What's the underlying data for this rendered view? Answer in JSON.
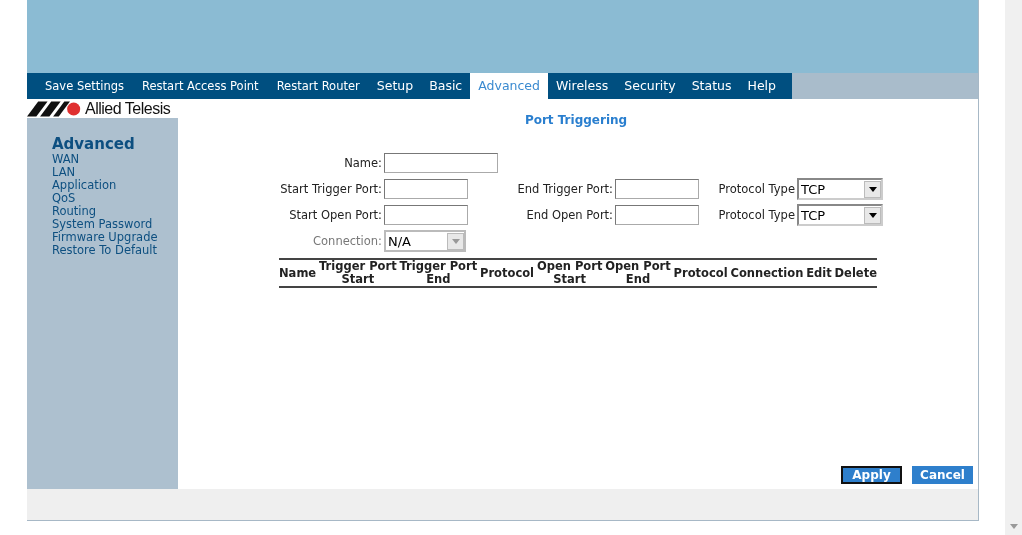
{
  "nav": [
    {
      "label": "Save Settings",
      "selected": false
    },
    {
      "label": "Restart Access Point",
      "selected": false
    },
    {
      "label": "Restart Router",
      "selected": false
    },
    {
      "label": "Setup",
      "selected": false
    },
    {
      "label": "Basic",
      "selected": false
    },
    {
      "label": "Advanced",
      "selected": true
    },
    {
      "label": "Wireless",
      "selected": false
    },
    {
      "label": "Security",
      "selected": false
    },
    {
      "label": "Status",
      "selected": false
    },
    {
      "label": "Help",
      "selected": false
    }
  ],
  "logo": {
    "text": "Allied Telesis"
  },
  "sidebar": {
    "title": "Advanced",
    "items": [
      "WAN",
      "LAN",
      "Application",
      "QoS",
      "Routing",
      "System Password",
      "Firmware Upgrade",
      "Restore To Default"
    ]
  },
  "page_title": "Port Triggering",
  "form": {
    "name_label": "Name:",
    "start_trigger_label": "Start Trigger Port:",
    "end_trigger_label": "End Trigger Port:",
    "protocol_label_1": "Protocol Type",
    "protocol_1": "TCP",
    "start_open_label": "Start Open Port:",
    "end_open_label": "End Open Port:",
    "protocol_label_2": "Protocol Type",
    "protocol_2": "TCP",
    "connection_label": "Connection:",
    "connection": "N/A",
    "connection_disabled": true
  },
  "table": {
    "columns": [
      [
        "Name"
      ],
      [
        "Trigger Port",
        "Start"
      ],
      [
        "Trigger Port",
        "End"
      ],
      [
        "Protocol"
      ],
      [
        "Open Port",
        "Start"
      ],
      [
        "Open Port",
        "End"
      ],
      [
        "Protocol"
      ],
      [
        "Connection"
      ],
      [
        "Edit"
      ],
      [
        "Delete"
      ]
    ]
  },
  "buttons": [
    {
      "label": "Apply",
      "focused": true
    },
    {
      "label": "Cancel",
      "focused": false
    }
  ]
}
